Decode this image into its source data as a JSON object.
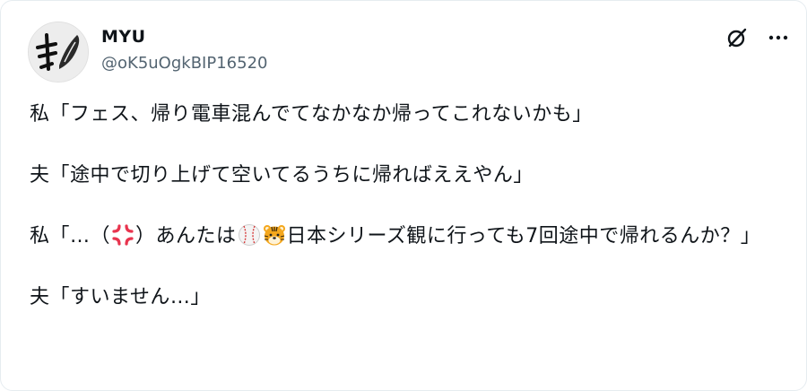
{
  "author": {
    "display_name": "MYU",
    "handle": "@oK5uOgkBIP16520"
  },
  "actions": {
    "grok_icon": "grok-icon",
    "more_icon": "more-icon"
  },
  "post": {
    "p1": "私「フェス、帰り電車混んでてなかなか帰ってこれないかも」",
    "p2": "夫「途中で切り上げて空いてるうちに帰ればええやん」",
    "p3_a": "私「…（",
    "p3_emoji1": "anger-symbol-emoji",
    "p3_b": "）あんたは",
    "p3_emoji2": "baseball-emoji",
    "p3_emoji3": "tiger-face-emoji",
    "p3_c": "日本シリーズ観に行っても7回途中で帰れるんか？」",
    "p4": "夫「すいません…」"
  },
  "colors": {
    "text": "#0f1419",
    "secondary": "#536471",
    "anger": "#e8344e",
    "tiger": "#f4a71d"
  }
}
